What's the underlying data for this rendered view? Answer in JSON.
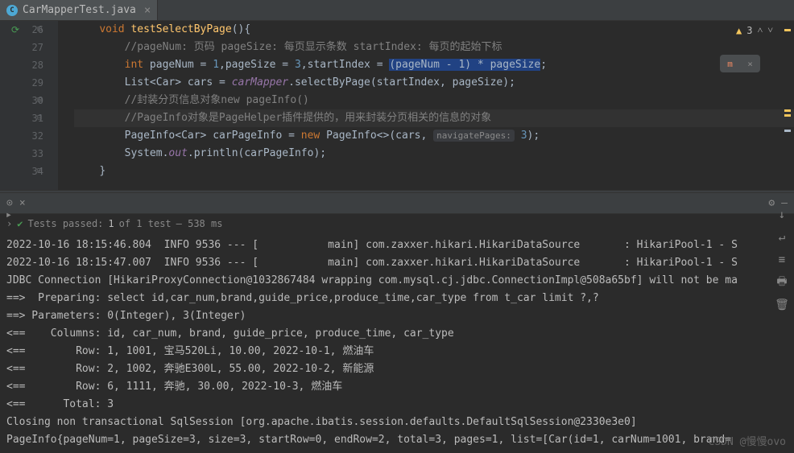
{
  "tab": {
    "filename": "CarMapperTest.java",
    "icon_letter": "C"
  },
  "warnings": {
    "count": "3"
  },
  "gutter": {
    "lines": [
      "26",
      "27",
      "28",
      "29",
      "30",
      "31",
      "32",
      "33",
      "34"
    ]
  },
  "code": {
    "l26_kw": "void ",
    "l26_method": "testSelectByPage",
    "l26_rest": "(){",
    "l27": "//pageNum: 页码 pageSize: 每页显示条数 startIndex: 每页的起始下标",
    "l28_a": "int",
    "l28_b": " pageNum = ",
    "l28_c": "1",
    "l28_d": ",pageSize = ",
    "l28_e": "3",
    "l28_f": ",startIndex = ",
    "l28_g": "(pageNum - 1) * pageSize",
    "l28_h": ";",
    "l29_a": "List<Car> cars = ",
    "l29_b": "carMapper",
    "l29_c": ".selectByPage(startIndex, pageSize);",
    "l30": "//封装分页信息对象new pageInfo()",
    "l31": "//PageInfo对象是PageHelper插件提供的，用来封装分页相关的信息的对象",
    "l32_a": "PageInfo<Car> carPageInfo = ",
    "l32_b": "new ",
    "l32_c": "PageInfo<>(cars, ",
    "l32_hint": "navigatePages:",
    "l32_d": " 3",
    "l32_e": ");",
    "l33_a": "System.",
    "l33_b": "out",
    "l33_c": ".println(carPageInfo);",
    "l34": "}"
  },
  "tests": {
    "status_prefix": "Tests passed: ",
    "passed": "1",
    "of": " of 1 test",
    "time": " – 538 ms"
  },
  "console": {
    "l1": "2022-10-16 18:15:46.804  INFO 9536 --- [           main] com.zaxxer.hikari.HikariDataSource       : HikariPool-1 - S",
    "l2": "2022-10-16 18:15:47.007  INFO 9536 --- [           main] com.zaxxer.hikari.HikariDataSource       : HikariPool-1 - S",
    "l3": "JDBC Connection [HikariProxyConnection@1032867484 wrapping com.mysql.cj.jdbc.ConnectionImpl@508a65bf] will not be ma",
    "l4": "==>  Preparing: select id,car_num,brand,guide_price,produce_time,car_type from t_car limit ?,?",
    "l5": "==> Parameters: 0(Integer), 3(Integer)",
    "l6": "<==    Columns: id, car_num, brand, guide_price, produce_time, car_type",
    "l7": "<==        Row: 1, 1001, 宝马520Li, 10.00, 2022-10-1, 燃油车",
    "l8": "<==        Row: 2, 1002, 奔驰E300L, 55.00, 2022-10-2, 新能源",
    "l9": "<==        Row: 6, 1111, 奔驰, 30.00, 2022-10-3, 燃油车",
    "l10": "<==      Total: 3",
    "l11": "Closing non transactional SqlSession [org.apache.ibatis.session.defaults.DefaultSqlSession@2330e3e0]",
    "l12": "PageInfo{pageNum=1, pageSize=3, size=3, startRow=0, endRow=2, total=3, pages=1, list=[Car(id=1, carNum=1001, brand="
  },
  "watermark": "CSDN @慢慢ovo",
  "floating": {
    "letter": "m"
  }
}
